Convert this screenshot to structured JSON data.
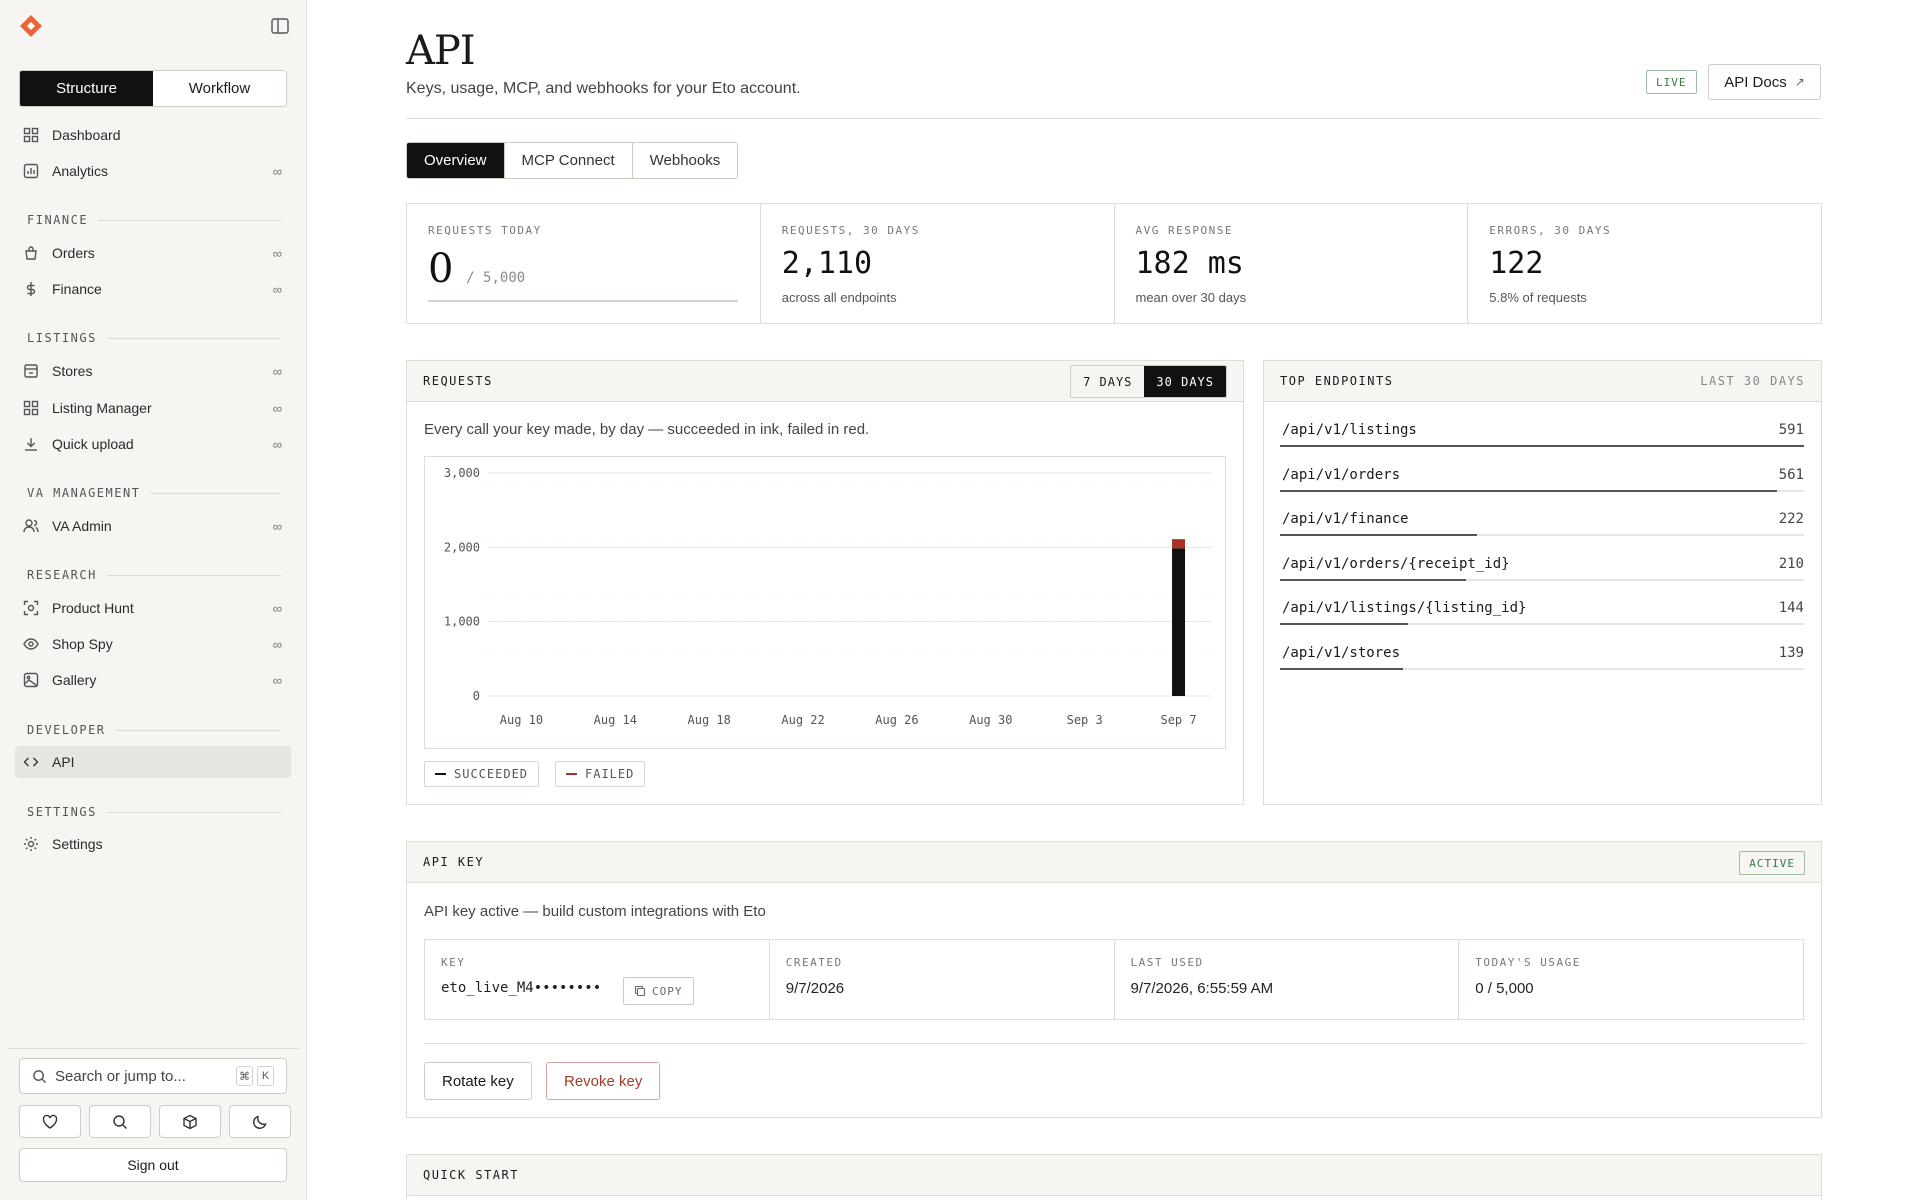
{
  "sidebar": {
    "segments": [
      "Structure",
      "Workflow"
    ],
    "items": {
      "dashboard": "Dashboard",
      "analytics": "Analytics",
      "orders": "Orders",
      "finance": "Finance",
      "stores": "Stores",
      "listing_manager": "Listing Manager",
      "quick_upload": "Quick upload",
      "va_admin": "VA Admin",
      "product_hunt": "Product Hunt",
      "shop_spy": "Shop Spy",
      "gallery": "Gallery",
      "api": "API",
      "settings": "Settings"
    },
    "infinity": "∞",
    "sections": {
      "finance": "FINANCE",
      "listings": "LISTINGS",
      "va": "VA MANAGEMENT",
      "research": "RESEARCH",
      "developer": "DEVELOPER",
      "settings": "SETTINGS"
    },
    "search_placeholder": "Search or jump to...",
    "kbd": [
      "⌘",
      "K"
    ],
    "sign_out": "Sign out"
  },
  "header": {
    "title": "API",
    "subtitle": "Keys, usage, MCP, and webhooks for your Eto account.",
    "live_badge": "LIVE",
    "docs_button": "API Docs",
    "docs_arrow": "↗"
  },
  "tabs": [
    "Overview",
    "MCP Connect",
    "Webhooks"
  ],
  "stats": [
    {
      "label": "REQUESTS TODAY",
      "value": "0",
      "suffix": "/ 5,000",
      "progress": 0
    },
    {
      "label": "REQUESTS, 30 DAYS",
      "value": "2,110",
      "sub": "across all endpoints"
    },
    {
      "label": "AVG RESPONSE",
      "value": "182 ms",
      "sub": "mean over 30 days"
    },
    {
      "label": "ERRORS, 30 DAYS",
      "value": "122",
      "sub": "5.8% of requests"
    }
  ],
  "requests_panel": {
    "title": "REQUESTS",
    "ranges": [
      "7 DAYS",
      "30 DAYS"
    ],
    "selected_range": "30 DAYS",
    "description": "Every call your key made, by day — succeeded in ink, failed in red.",
    "legend": [
      "SUCCEEDED",
      "FAILED"
    ]
  },
  "chart_data": {
    "type": "bar",
    "stacked": true,
    "x_tick_labels": [
      "Aug 10",
      "Aug 14",
      "Aug 18",
      "Aug 22",
      "Aug 26",
      "Aug 30",
      "Sep 3",
      "Sep 7"
    ],
    "y_tick_labels": [
      "3,000",
      "2,000",
      "1,000",
      "0"
    ],
    "ylim": [
      0,
      3000
    ],
    "x": [
      "Aug 9",
      "Aug 10",
      "Aug 11",
      "Aug 12",
      "Aug 13",
      "Aug 14",
      "Aug 15",
      "Aug 16",
      "Aug 17",
      "Aug 18",
      "Aug 19",
      "Aug 20",
      "Aug 21",
      "Aug 22",
      "Aug 23",
      "Aug 24",
      "Aug 25",
      "Aug 26",
      "Aug 27",
      "Aug 28",
      "Aug 29",
      "Aug 30",
      "Aug 31",
      "Sep 1",
      "Sep 2",
      "Sep 3",
      "Sep 4",
      "Sep 5",
      "Sep 6",
      "Sep 7",
      "Sep 8"
    ],
    "series": [
      {
        "name": "SUCCEEDED",
        "color": "#111111",
        "values": [
          0,
          0,
          0,
          0,
          0,
          0,
          0,
          0,
          0,
          0,
          0,
          0,
          0,
          0,
          0,
          0,
          0,
          0,
          0,
          0,
          0,
          0,
          0,
          0,
          0,
          0,
          0,
          0,
          0,
          1988,
          0
        ]
      },
      {
        "name": "FAILED",
        "color": "#a83226",
        "values": [
          0,
          0,
          0,
          0,
          0,
          0,
          0,
          0,
          0,
          0,
          0,
          0,
          0,
          0,
          0,
          0,
          0,
          0,
          0,
          0,
          0,
          0,
          0,
          0,
          0,
          0,
          0,
          0,
          0,
          122,
          0
        ]
      }
    ],
    "grid": true
  },
  "endpoints": {
    "title": "TOP ENDPOINTS",
    "range": "LAST 30 DAYS",
    "items": [
      {
        "path": "/api/v1/listings",
        "count": 591
      },
      {
        "path": "/api/v1/orders",
        "count": 561
      },
      {
        "path": "/api/v1/finance",
        "count": 222
      },
      {
        "path": "/api/v1/orders/{receipt_id}",
        "count": 210
      },
      {
        "path": "/api/v1/listings/{listing_id}",
        "count": 144
      },
      {
        "path": "/api/v1/stores",
        "count": 139
      }
    ]
  },
  "api_key": {
    "title": "API KEY",
    "status": "ACTIVE",
    "description": "API key active — build custom integrations with Eto",
    "key_label": "KEY",
    "key_value": "eto_live_M4••••••••",
    "copy": "COPY",
    "created_label": "CREATED",
    "created_value": "9/7/2026",
    "last_used_label": "LAST USED",
    "last_used_value": "9/7/2026, 6:55:59 AM",
    "usage_label": "TODAY'S USAGE",
    "usage_value": "0 / 5,000",
    "rotate": "Rotate key",
    "revoke": "Revoke key"
  },
  "quick_start": {
    "title": "QUICK START"
  },
  "colors": {
    "accent": "#e8643a",
    "ink": "#111111",
    "failed": "#a83226",
    "live": "#3c7a4b"
  }
}
